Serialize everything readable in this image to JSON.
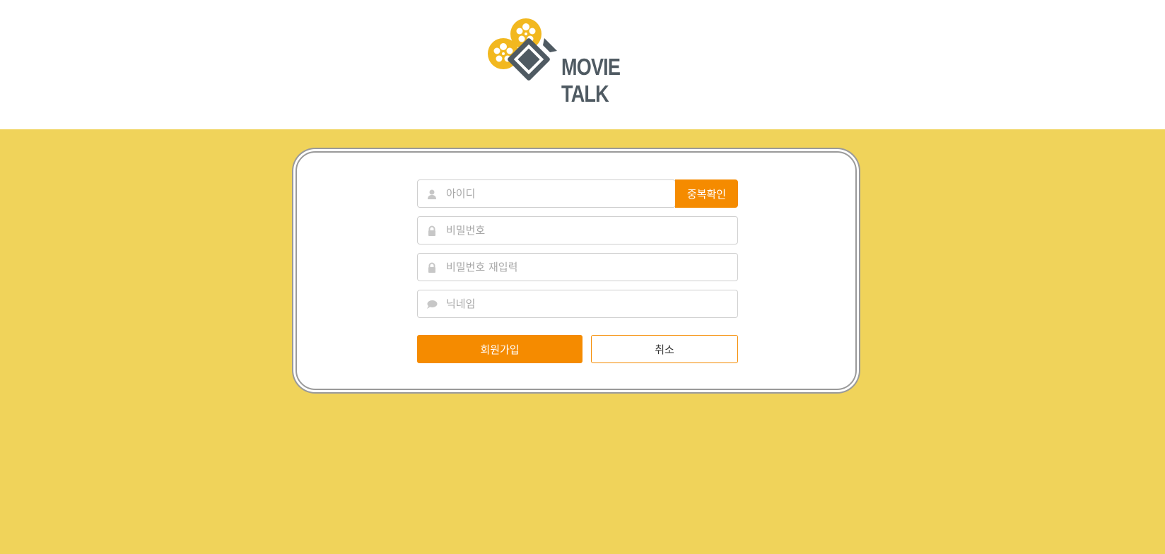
{
  "brand": {
    "logo_line1": "MOVIE",
    "logo_line2": "TALK",
    "logo_icon": "film-camera-icon",
    "colors": {
      "reel": "#f2b81f",
      "camera": "#4f5a62",
      "text": "#4f5a62"
    }
  },
  "form": {
    "id_placeholder": "아이디",
    "id_icon": "user-icon",
    "check_duplicate_label": "중복확인",
    "password_placeholder": "비밀번호",
    "password_icon": "lock-icon",
    "password_confirm_placeholder": "비밀번호 재입력",
    "password_confirm_icon": "lock-icon",
    "nickname_placeholder": "닉네임",
    "nickname_icon": "speech-bubble-icon",
    "signup_label": "회원가입",
    "cancel_label": "취소"
  },
  "colors": {
    "page_background": "#f0d35a",
    "accent": "#f58b00",
    "card_border": "#9a9a9a",
    "placeholder": "#a8a8a8"
  }
}
